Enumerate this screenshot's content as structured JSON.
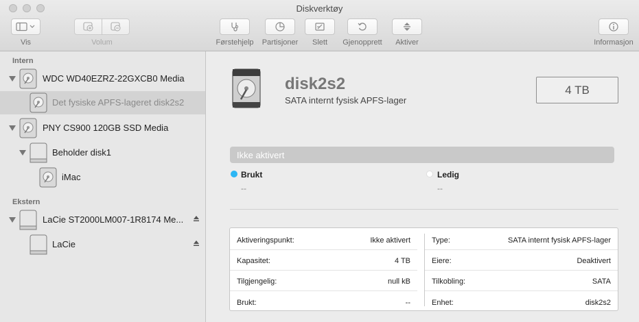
{
  "window": {
    "title": "Diskverktøy"
  },
  "toolbar": {
    "vis": "Vis",
    "volum": "Volum",
    "forstehjelp": "Førstehjelp",
    "partisjoner": "Partisjoner",
    "slett": "Slett",
    "gjenopprett": "Gjenopprett",
    "aktiver": "Aktiver",
    "informasjon": "Informasjon"
  },
  "sidebar": {
    "intern_header": "Intern",
    "ekstern_header": "Ekstern",
    "items": [
      {
        "label": "WDC WD40EZRZ-22GXCB0 Media"
      },
      {
        "label": "Det fysiske APFS-lageret disk2s2"
      },
      {
        "label": "PNY CS900 120GB SSD Media"
      },
      {
        "label": "Beholder disk1"
      },
      {
        "label": "iMac"
      },
      {
        "label": "LaCie ST2000LM007-1R8174 Me..."
      },
      {
        "label": "LaCie"
      }
    ]
  },
  "main": {
    "disk_name": "disk2s2",
    "disk_subtitle": "SATA internt fysisk APFS-lager",
    "size": "4 TB",
    "usage_bar_label": "Ikke aktivert",
    "legend": {
      "used_label": "Brukt",
      "used_value": "--",
      "free_label": "Ledig",
      "free_value": "--"
    },
    "colors": {
      "used_dot": "#2cb6f4",
      "free_dot": "#ffffff"
    },
    "info_left": [
      {
        "key": "Aktiveringspunkt:",
        "value": "Ikke aktivert"
      },
      {
        "key": "Kapasitet:",
        "value": "4 TB"
      },
      {
        "key": "Tilgjengelig:",
        "value": "null kB"
      },
      {
        "key": "Brukt:",
        "value": "--"
      }
    ],
    "info_right": [
      {
        "key": "Type:",
        "value": "SATA internt fysisk APFS-lager"
      },
      {
        "key": "Eiere:",
        "value": "Deaktivert"
      },
      {
        "key": "Tilkobling:",
        "value": "SATA"
      },
      {
        "key": "Enhet:",
        "value": "disk2s2"
      }
    ]
  }
}
